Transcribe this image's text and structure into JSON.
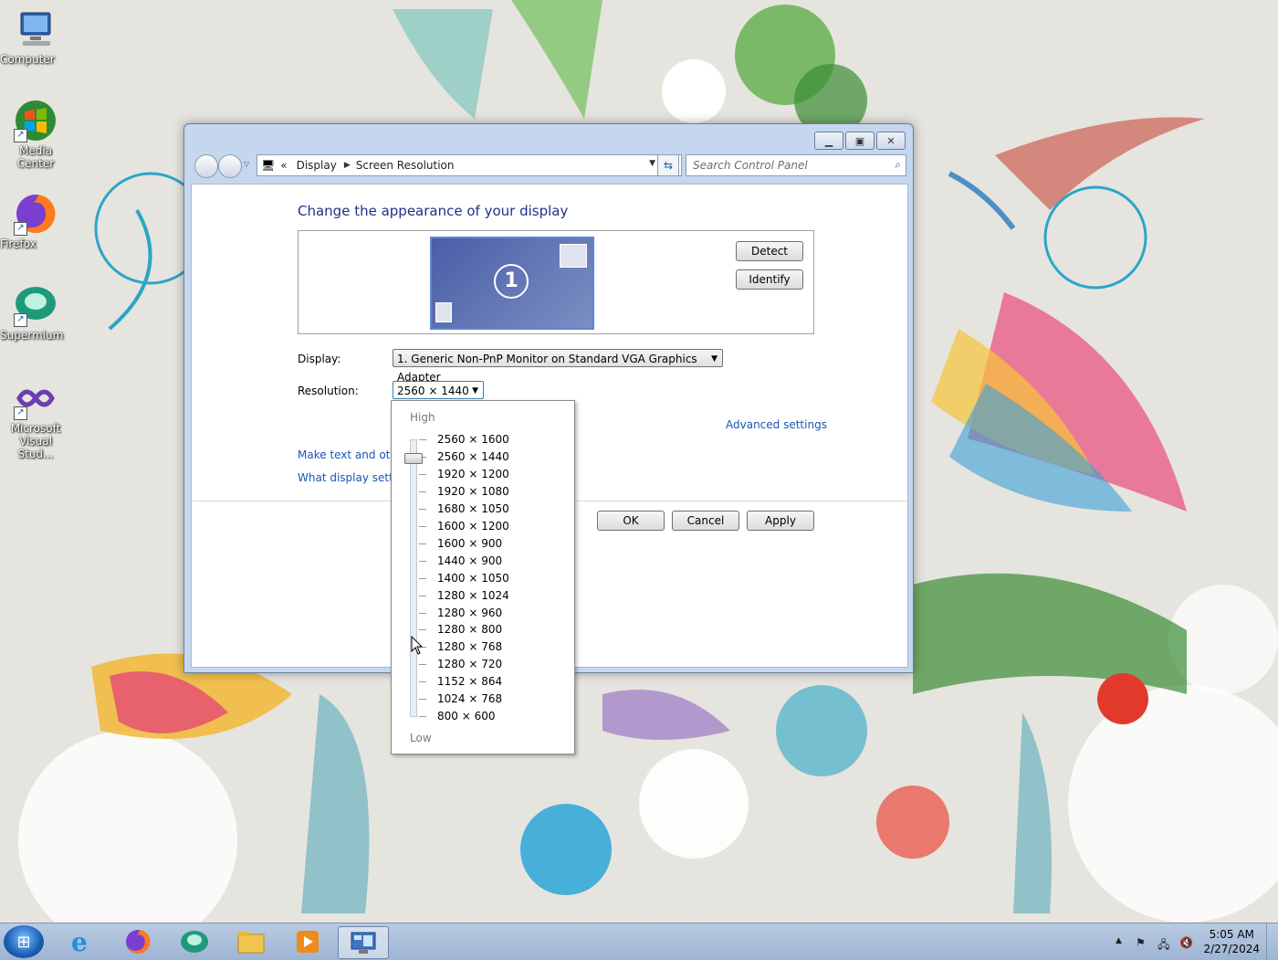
{
  "desktop": {
    "icons": [
      {
        "label": "Computer"
      },
      {
        "label": "Media Center"
      },
      {
        "label": "Firefox"
      },
      {
        "label": "Supermium"
      },
      {
        "label": "Microsoft Visual Stud..."
      }
    ]
  },
  "window": {
    "breadcrumb": [
      "Display",
      "Screen Resolution"
    ],
    "breadcrumb_prefix": "«",
    "search_placeholder": "Search Control Panel",
    "heading": "Change the appearance of your display",
    "monitor_number": "1",
    "detect_label": "Detect",
    "identify_label": "Identify",
    "display_label": "Display:",
    "display_value": "1. Generic Non-PnP Monitor on Standard VGA Graphics Adapter",
    "resolution_label": "Resolution:",
    "resolution_value": "2560 × 1440",
    "advanced_link": "Advanced settings",
    "link_text_size": "Make text and other",
    "link_display_settings": "What display setting",
    "ok_label": "OK",
    "cancel_label": "Cancel",
    "apply_label": "Apply"
  },
  "resolution_popup": {
    "high_label": "High",
    "low_label": "Low",
    "options": [
      "2560 × 1600",
      "2560 × 1440",
      "1920 × 1200",
      "1920 × 1080",
      "1680 × 1050",
      "1600 × 1200",
      "1600 × 900",
      "1440 × 900",
      "1400 × 1050",
      "1280 × 1024",
      "1280 × 960",
      "1280 × 800",
      "1280 × 768",
      "1280 × 720",
      "1152 × 864",
      "1024 × 768",
      "800 × 600"
    ],
    "selected_index": 1
  },
  "taskbar": {
    "time": "5:05 AM",
    "date": "2/27/2024"
  }
}
